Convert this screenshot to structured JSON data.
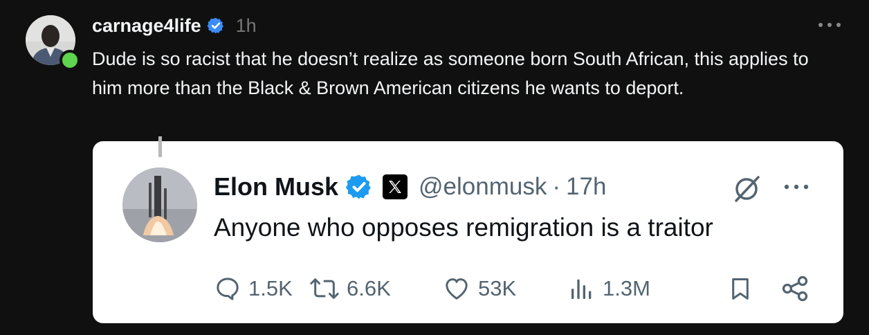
{
  "post": {
    "username": "carnage4life",
    "time": "1h",
    "text": "Dude is so racist that he doesn’t realize as someone born South African, this applies to him more than the Black & Brown American citizens he wants to deport.",
    "online_color": "#5ed44f",
    "verified_color": "#3b8cf6"
  },
  "quoted_post": {
    "name": "Elon Musk",
    "handle": "@elonmusk",
    "separator": "·",
    "time": "17h",
    "text": "Anyone who opposes remigration is a traitor",
    "verified_color": "#1d9bf0",
    "icons": [
      "verified-badge-icon",
      "x-logo-icon",
      "grok-icon",
      "more-icon"
    ],
    "actions": {
      "replies": "1.5K",
      "reposts": "6.6K",
      "likes": "53K",
      "views": "1.3M"
    }
  },
  "top_menu_icon": "more-horizontal-icon"
}
